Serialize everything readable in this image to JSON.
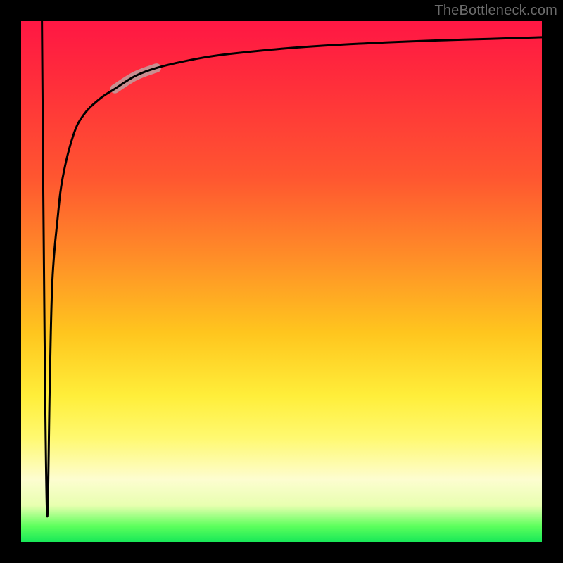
{
  "watermark": "TheBottleneck.com",
  "chart_data": {
    "type": "line",
    "title": "",
    "xlabel": "",
    "ylabel": "",
    "xlim": [
      0,
      100
    ],
    "ylim": [
      0,
      100
    ],
    "grid": false,
    "series": [
      {
        "name": "curve",
        "x": [
          4,
          4.5,
          5,
          5.5,
          6,
          7,
          8,
          10,
          12,
          15,
          18,
          22,
          26,
          30,
          35,
          40,
          50,
          60,
          70,
          80,
          90,
          100
        ],
        "y": [
          100,
          40,
          5,
          30,
          50,
          62,
          70,
          78,
          82,
          85,
          87,
          89.5,
          91,
          92,
          93,
          93.7,
          94.7,
          95.4,
          95.9,
          96.3,
          96.6,
          96.9
        ]
      }
    ],
    "annotations": [
      {
        "name": "highlight-segment",
        "x_range": [
          18,
          26
        ],
        "y_range": [
          87,
          91
        ],
        "style": "thick-muted-overlay"
      }
    ]
  },
  "colors": {
    "curve": "#000000",
    "highlight": "#bfa0a0",
    "frame": "#000000"
  }
}
